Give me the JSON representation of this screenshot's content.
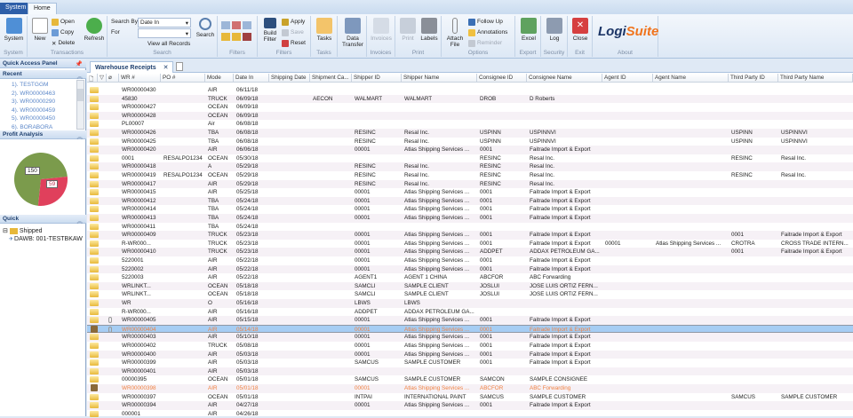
{
  "tabs": {
    "system": "System",
    "home": "Home"
  },
  "ribbon": {
    "system": {
      "btn": "System",
      "group": "System"
    },
    "transactions": {
      "new": "New",
      "open": "Open",
      "copy": "Copy",
      "delete": "Delete",
      "refresh": "Refresh",
      "group": "Transactions"
    },
    "search": {
      "search_by_label": "Search By",
      "search_by_value": "Date In",
      "for_label": "For",
      "for_value": "",
      "view_all": "View all Records",
      "search_btn": "Search",
      "group": "Search"
    },
    "filters1": {
      "group": "Filters"
    },
    "filters2": {
      "build": "Build Filter",
      "apply": "Apply",
      "save": "Save",
      "reset": "Reset",
      "group": "Filters"
    },
    "tasks": {
      "btn": "Tasks",
      "group": "Tasks"
    },
    "data_transfer": {
      "btn": "Data Transfer"
    },
    "invoices": {
      "btn": "Invoices",
      "group": "Invoices"
    },
    "print": {
      "print": "Print",
      "labels": "Labels",
      "group": "Print"
    },
    "options": {
      "attach": "Attach File",
      "follow_up": "Follow Up",
      "annotations": "Annotations",
      "reminder": "Reminder",
      "group": "Options"
    },
    "export": {
      "btn": "Excel",
      "group": "Export"
    },
    "security": {
      "btn": "Log",
      "group": "Security"
    },
    "exit": {
      "btn": "Close",
      "group": "Exit"
    },
    "about": {
      "logo_a": "Logi",
      "logo_b": "Suite",
      "group": "About"
    }
  },
  "left": {
    "title": "Quick Access Panel",
    "recent_title": "Recent",
    "recent": [
      "1). TESTGGM",
      "2). WR00000463",
      "3). WR00000290",
      "4). WR00000459",
      "5). WR00000450",
      "6). BORABORA"
    ],
    "profit_title": "Profit Analysis",
    "profit": {
      "a": 150,
      "b": 59
    },
    "quick_title": "Quick",
    "tree_root": "Shipped",
    "tree_child": "DAWB: 001-TESTBKAW"
  },
  "doc_tab": "Warehouse Receipts",
  "columns": [
    "WR #",
    "PO #",
    "Mode",
    "Date In",
    "Shipping Date",
    "Shipment Ca...",
    "Shipper ID",
    "Shipper Name",
    "Consignee ID",
    "Consignee Name",
    "Agent ID",
    "Agent Name",
    "Third Party ID",
    "Third Party Name"
  ],
  "colors": {
    "highlight": "#a6cdf3",
    "orange": "#f08040"
  },
  "rows": [
    {
      "icon": "folder",
      "v": [
        "WR00000430",
        "",
        "AIR",
        "06/11/18",
        "",
        "",
        "",
        "",
        "",
        "",
        "",
        "",
        "",
        ""
      ]
    },
    {
      "icon": "folder",
      "v": [
        "45830",
        "",
        "TRUCK",
        "06/09/18",
        "",
        "AECON",
        "WALMART",
        "WALMART",
        "DROB",
        "D Roberts",
        "",
        "",
        "",
        ""
      ]
    },
    {
      "icon": "folder",
      "v": [
        "WR00000427",
        "",
        "OCEAN",
        "06/09/18",
        "",
        "",
        "",
        "",
        "",
        "",
        "",
        "",
        "",
        ""
      ]
    },
    {
      "icon": "folder",
      "v": [
        "WR00000428",
        "",
        "OCEAN",
        "06/09/18",
        "",
        "",
        "",
        "",
        "",
        "",
        "",
        "",
        "",
        ""
      ]
    },
    {
      "icon": "folder",
      "v": [
        "PL00007",
        "",
        "Air",
        "06/08/18",
        "",
        "",
        "",
        "",
        "",
        "",
        "",
        "",
        "",
        ""
      ]
    },
    {
      "icon": "folder",
      "v": [
        "WR00000426",
        "",
        "TBA",
        "06/08/18",
        "",
        "",
        "RESINC",
        "Resal Inc.",
        "USPINN",
        "USPINNVI",
        "",
        "",
        "USPINN",
        "USPINNVI"
      ]
    },
    {
      "icon": "folder",
      "v": [
        "WR00000425",
        "",
        "TBA",
        "06/08/18",
        "",
        "",
        "RESINC",
        "Resal Inc.",
        "USPINN",
        "USPINNVI",
        "",
        "",
        "USPINN",
        "USPINNVI"
      ]
    },
    {
      "icon": "folder",
      "v": [
        "WR00000420",
        "",
        "AIR",
        "06/06/18",
        "",
        "",
        "00001",
        "Atlas Shipping Services ...",
        "0001",
        "Faitrade Import & Export",
        "",
        "",
        "",
        ""
      ]
    },
    {
      "icon": "folder",
      "v": [
        "0001",
        "RESALPO1234",
        "OCEAN",
        "05/30/18",
        "",
        "",
        "",
        "",
        "RESINC",
        "Resal Inc.",
        "",
        "",
        "RESINC",
        "Resal Inc."
      ]
    },
    {
      "icon": "folder",
      "v": [
        "WR00000418",
        "",
        "A",
        "05/29/18",
        "",
        "",
        "RESINC",
        "Resal Inc.",
        "RESINC",
        "Resal Inc.",
        "",
        "",
        "",
        ""
      ]
    },
    {
      "icon": "folder",
      "v": [
        "WR00000419",
        "RESALPO1234",
        "OCEAN",
        "05/29/18",
        "",
        "",
        "RESINC",
        "Resal Inc.",
        "RESINC",
        "Resal Inc.",
        "",
        "",
        "RESINC",
        "Resal Inc."
      ]
    },
    {
      "icon": "folder",
      "v": [
        "WR00000417",
        "",
        "AIR",
        "05/29/18",
        "",
        "",
        "RESINC",
        "Resal Inc.",
        "RESINC",
        "Resal Inc.",
        "",
        "",
        "",
        ""
      ]
    },
    {
      "icon": "folder",
      "v": [
        "WR00000415",
        "",
        "AIR",
        "05/25/18",
        "",
        "",
        "00001",
        "Atlas Shipping Services ...",
        "0001",
        "Faitrade Import & Export",
        "",
        "",
        "",
        ""
      ]
    },
    {
      "icon": "folder",
      "v": [
        "WR00000412",
        "",
        "TBA",
        "05/24/18",
        "",
        "",
        "00001",
        "Atlas Shipping Services ...",
        "0001",
        "Faitrade Import & Export",
        "",
        "",
        "",
        ""
      ]
    },
    {
      "icon": "folder",
      "v": [
        "WR00000414",
        "",
        "TBA",
        "05/24/18",
        "",
        "",
        "00001",
        "Atlas Shipping Services ...",
        "0001",
        "Faitrade Import & Export",
        "",
        "",
        "",
        ""
      ]
    },
    {
      "icon": "folder",
      "v": [
        "WR00000413",
        "",
        "TBA",
        "05/24/18",
        "",
        "",
        "00001",
        "Atlas Shipping Services ...",
        "0001",
        "Faitrade Import & Export",
        "",
        "",
        "",
        ""
      ]
    },
    {
      "icon": "folder",
      "v": [
        "WR00000411",
        "",
        "TBA",
        "05/24/18",
        "",
        "",
        "",
        "",
        "",
        "",
        "",
        "",
        "",
        ""
      ]
    },
    {
      "icon": "folder",
      "v": [
        "WR00000409",
        "",
        "TRUCK",
        "05/23/18",
        "",
        "",
        "00001",
        "Atlas Shipping Services ...",
        "0001",
        "Faitrade Import & Export",
        "",
        "",
        "0001",
        "Faitrade Import & Export"
      ]
    },
    {
      "icon": "folder",
      "v": [
        "R-WR000...",
        "",
        "TRUCK",
        "05/23/18",
        "",
        "",
        "00001",
        "Atlas Shipping Services ...",
        "0001",
        "Faitrade Import & Export",
        "00001",
        "Atlas Shipping Services ...",
        "CROTRA",
        "CROSS TRADE INTERN..."
      ]
    },
    {
      "icon": "folder",
      "v": [
        "WR00000410",
        "",
        "TRUCK",
        "05/23/18",
        "",
        "",
        "00001",
        "Atlas Shipping Services ...",
        "ADDPET",
        "ADDAX PETROLEUM GA...",
        "",
        "",
        "0001",
        "Faitrade Import & Export"
      ]
    },
    {
      "icon": "folder",
      "v": [
        "5220001",
        "",
        "AIR",
        "05/22/18",
        "",
        "",
        "00001",
        "Atlas Shipping Services ...",
        "0001",
        "Faitrade Import & Export",
        "",
        "",
        "",
        ""
      ]
    },
    {
      "icon": "folder",
      "v": [
        "5220002",
        "",
        "AIR",
        "05/22/18",
        "",
        "",
        "00001",
        "Atlas Shipping Services ...",
        "0001",
        "Faitrade Import & Export",
        "",
        "",
        "",
        ""
      ]
    },
    {
      "icon": "folder",
      "v": [
        "5220003",
        "",
        "AIR",
        "05/22/18",
        "",
        "",
        "AGENT1",
        "AGENT 1 CHINA",
        "ABCFOR",
        "ABC Forwarding",
        "",
        "",
        "",
        ""
      ]
    },
    {
      "icon": "folder",
      "v": [
        "WRLINKT...",
        "",
        "OCEAN",
        "05/18/18",
        "",
        "",
        "SAMCLI",
        "SAMPLE CLIENT",
        "JOSLUI",
        "JOSE LUIS ORTIZ FERN...",
        "",
        "",
        "",
        ""
      ]
    },
    {
      "icon": "folder",
      "v": [
        "WRLINKT...",
        "",
        "OCEAN",
        "05/18/18",
        "",
        "",
        "SAMCLI",
        "SAMPLE CLIENT",
        "JOSLUI",
        "JOSE LUIS ORTIZ FERN...",
        "",
        "",
        "",
        ""
      ]
    },
    {
      "icon": "folder",
      "v": [
        "WR",
        "",
        "O",
        "05/16/18",
        "",
        "",
        "LBWS",
        "LBWS",
        "",
        "",
        "",
        "",
        "",
        ""
      ]
    },
    {
      "icon": "folder",
      "v": [
        "R-WR000...",
        "",
        "AIR",
        "05/16/18",
        "",
        "",
        "ADDPET",
        "ADDAX PETROLEUM GA...",
        "",
        "",
        "",
        "",
        "",
        ""
      ]
    },
    {
      "icon": "folder",
      "attach": true,
      "v": [
        "WR00000405",
        "",
        "AIR",
        "05/15/18",
        "",
        "",
        "00001",
        "Atlas Shipping Services ...",
        "0001",
        "Faitrade Import & Export",
        "",
        "",
        "",
        ""
      ]
    },
    {
      "icon": "package",
      "attach": true,
      "selected": true,
      "orange": true,
      "v": [
        "WR00000404",
        "",
        "AIR",
        "05/14/18",
        "",
        "",
        "00001",
        "Atlas Shipping Services ...",
        "0001",
        "Faitrade Import & Export",
        "",
        "",
        "",
        ""
      ]
    },
    {
      "icon": "folder",
      "v": [
        "WR00000403",
        "",
        "AIR",
        "05/10/18",
        "",
        "",
        "00001",
        "Atlas Shipping Services ...",
        "0001",
        "Faitrade Import & Export",
        "",
        "",
        "",
        ""
      ]
    },
    {
      "icon": "folder",
      "v": [
        "WR00000402",
        "",
        "TRUCK",
        "05/08/18",
        "",
        "",
        "00001",
        "Atlas Shipping Services ...",
        "0001",
        "Faitrade Import & Export",
        "",
        "",
        "",
        ""
      ]
    },
    {
      "icon": "folder",
      "v": [
        "WR00000400",
        "",
        "AIR",
        "05/03/18",
        "",
        "",
        "00001",
        "Atlas Shipping Services ...",
        "0001",
        "Faitrade Import & Export",
        "",
        "",
        "",
        ""
      ]
    },
    {
      "icon": "folder",
      "v": [
        "WR00000399",
        "",
        "AIR",
        "05/03/18",
        "",
        "",
        "SAMCUS",
        "SAMPLE CUSTOMER",
        "0001",
        "Faitrade Import & Export",
        "",
        "",
        "",
        ""
      ]
    },
    {
      "icon": "folder",
      "v": [
        "WR00000401",
        "",
        "AIR",
        "05/03/18",
        "",
        "",
        "",
        "",
        "",
        "",
        "",
        "",
        "",
        ""
      ]
    },
    {
      "icon": "folder",
      "v": [
        "00000395",
        "",
        "OCEAN",
        "05/01/18",
        "",
        "",
        "SAMCUS",
        "SAMPLE CUSTOMER",
        "SAMCON",
        "SAMPLE CONSIGNEE",
        "",
        "",
        "",
        ""
      ]
    },
    {
      "icon": "package",
      "orange": true,
      "v": [
        "WR00000398",
        "",
        "AIR",
        "05/01/18",
        "",
        "",
        "00001",
        "Atlas Shipping Services ...",
        "ABCFOR",
        "ABC Forwarding",
        "",
        "",
        "",
        ""
      ]
    },
    {
      "icon": "folder",
      "v": [
        "WR00000397",
        "",
        "OCEAN",
        "05/01/18",
        "",
        "",
        "INTPAI",
        "INTERNATIONAL PAINT",
        "SAMCUS",
        "SAMPLE CUSTOMER",
        "",
        "",
        "SAMCUS",
        "SAMPLE CUSTOMER"
      ]
    },
    {
      "icon": "folder",
      "v": [
        "WR00000394",
        "",
        "AIR",
        "04/27/18",
        "",
        "",
        "00001",
        "Atlas Shipping Services ...",
        "0001",
        "Faitrade Import & Export",
        "",
        "",
        "",
        ""
      ]
    },
    {
      "icon": "folder",
      "v": [
        "000001",
        "",
        "AIR",
        "04/26/18",
        "",
        "",
        "",
        "",
        "",
        "",
        "",
        "",
        "",
        ""
      ]
    }
  ]
}
